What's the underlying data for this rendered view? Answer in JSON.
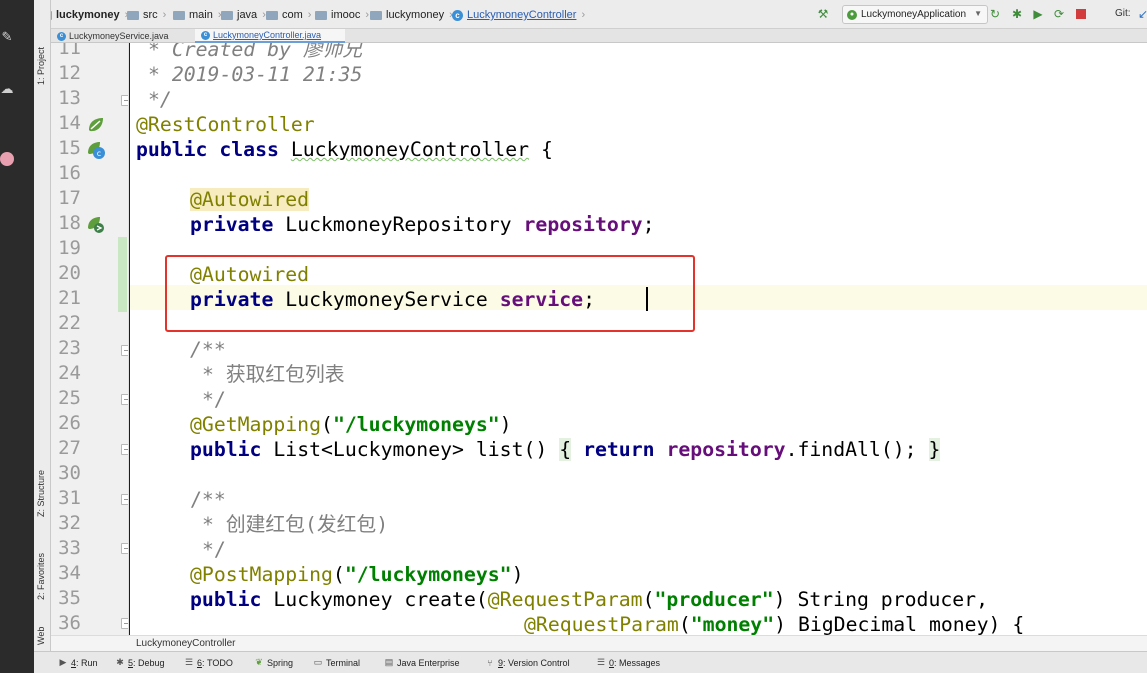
{
  "nav_bar": {
    "breadcrumbs": [
      "luckymoney",
      "src",
      "main",
      "java",
      "com",
      "imooc",
      "luckymoney",
      "LuckymoneyController"
    ],
    "run_config": "LuckymoneyApplication",
    "git_label": "Git:"
  },
  "left_tool_tabs": [
    "1: Project",
    "Z: Structure",
    "2: Favorites",
    "Web"
  ],
  "editor_tabs": [
    "LuckymoneyService.java",
    "LuckymoneyController.java"
  ],
  "active_tab": "LuckymoneyController.java",
  "code": {
    "line_numbers": [
      "11",
      "12",
      "13",
      "14",
      "15",
      "16",
      "17",
      "18",
      "19",
      "20",
      "21",
      "22",
      "23",
      "24",
      "25",
      "26",
      "27",
      "30",
      "31",
      "32",
      "33",
      "34",
      "35",
      "36"
    ],
    "lines": {
      "l11": "* Created by 廖师兄",
      "l12": "* 2019-03-11 21:35",
      "l13": "*/",
      "l14_annotation": "@RestController",
      "l15_kw": "public class",
      "l15_name": "LuckymoneyController",
      "l15_rest": "{",
      "l17": "@Autowired",
      "l18_kw": "private",
      "l18_type": "LuckmoneyRepository",
      "l18_field": "repository",
      "l20": "@Autowired",
      "l21_kw": "private",
      "l21_type": "LuckymoneyService",
      "l21_field": "service",
      "l23": "/**",
      "l24": "* 获取红包列表",
      "l25": "*/",
      "l26_ann": "@GetMapping",
      "l26_str": "\"/luckymoneys\"",
      "l27_kw": "public",
      "l27_sig": "List<Luckymoney> list()",
      "l27_return": "return",
      "l27_field": "repository",
      "l27_call": ".findAll();",
      "l31": "/**",
      "l32": "* 创建红包(发红包)",
      "l33": "*/",
      "l34_ann": "@PostMapping",
      "l34_str": "\"/luckymoneys\"",
      "l35_kw": "public",
      "l35_sig": "Luckymoney create(",
      "l35_ann": "@RequestParam",
      "l35_str": "\"producer\"",
      "l35_rest": "String producer,",
      "l36_ann": "@RequestParam",
      "l36_str": "\"money\"",
      "l36_rest": "BigDecimal money) {"
    }
  },
  "editor_breadcrumb": "LuckymoneyController",
  "bottom_tabs": [
    {
      "num": "4",
      "label": "Run"
    },
    {
      "num": "5",
      "label": "Debug"
    },
    {
      "num": "6",
      "label": "TODO"
    },
    {
      "num": "",
      "label": "Spring"
    },
    {
      "num": "",
      "label": "Terminal"
    },
    {
      "num": "",
      "label": "Java Enterprise"
    },
    {
      "num": "9",
      "label": "Version Control"
    },
    {
      "num": "0",
      "label": "Messages"
    }
  ],
  "colors": {
    "keyword": "#000080",
    "annotation": "#808000",
    "field": "#660e7a",
    "string": "#008000",
    "comment": "#808080",
    "highlight_box": "#e3332a"
  }
}
